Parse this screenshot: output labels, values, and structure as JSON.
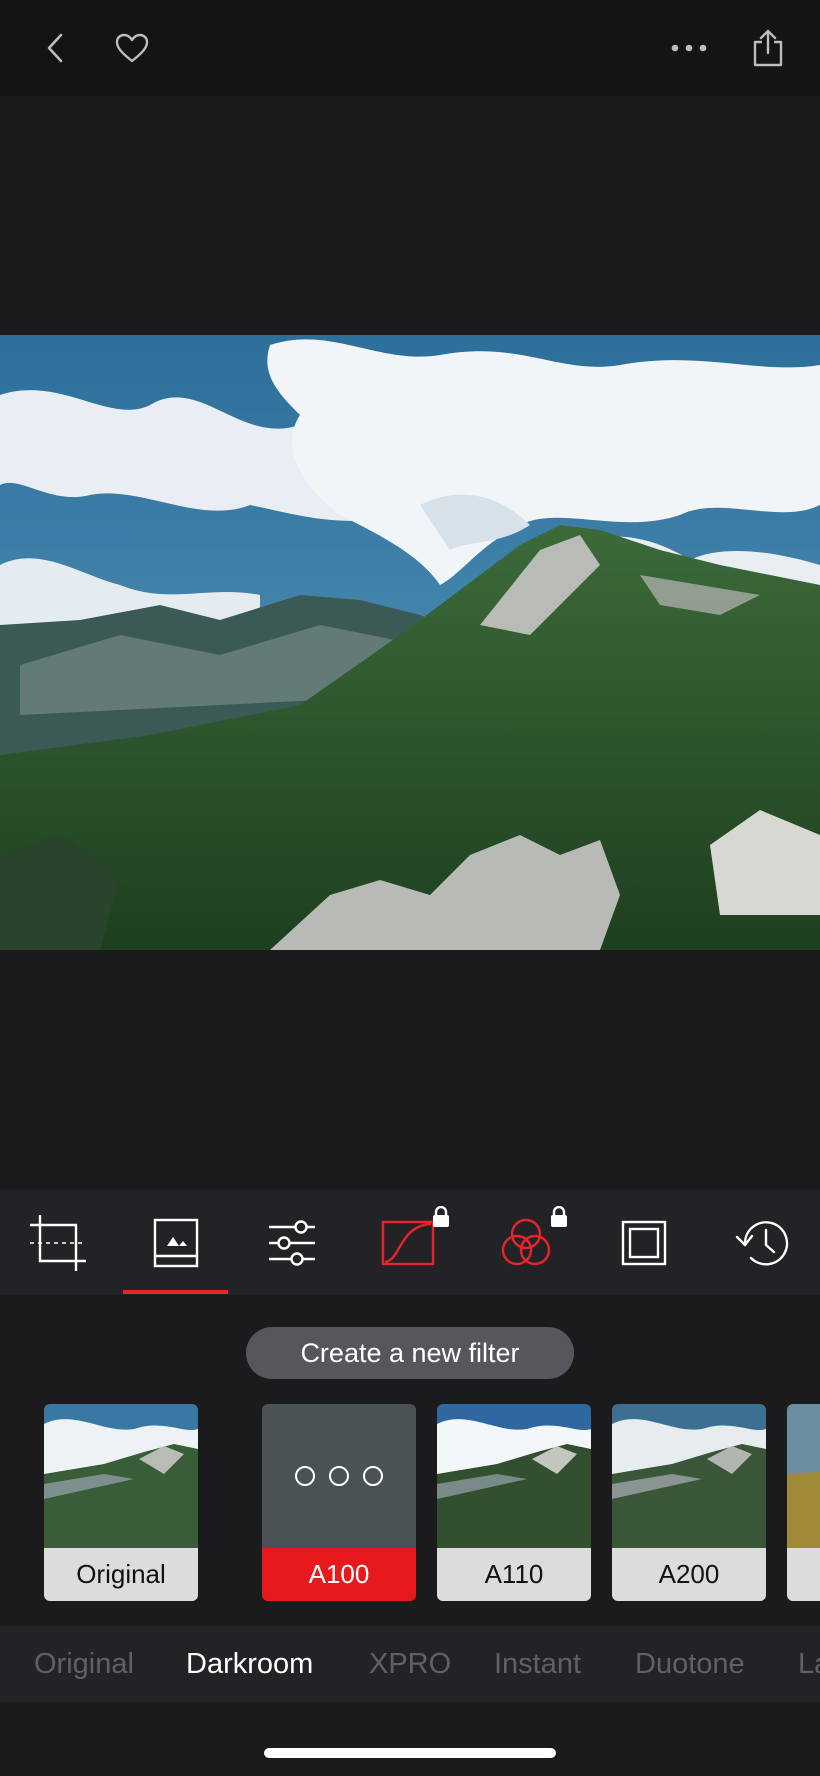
{
  "topbar": {
    "back_icon": "chevron-left-icon",
    "favorite_icon": "heart-icon",
    "more_icon": "ellipsis-icon",
    "share_icon": "share-icon"
  },
  "photo": {
    "subject": "mountain-landscape"
  },
  "toolbar": {
    "tools": [
      {
        "icon": "crop-icon",
        "locked": false
      },
      {
        "icon": "filters-icon",
        "locked": false,
        "active": true
      },
      {
        "icon": "adjust-sliders-icon",
        "locked": false
      },
      {
        "icon": "curves-icon",
        "locked": true
      },
      {
        "icon": "color-circles-icon",
        "locked": true
      },
      {
        "icon": "frame-icon",
        "locked": false
      },
      {
        "icon": "history-icon",
        "locked": false
      }
    ],
    "accent": "#e8242b"
  },
  "create_filter": {
    "label": "Create a new filter"
  },
  "filters": [
    {
      "label": "Original"
    },
    {
      "label": "A100",
      "selected": true
    },
    {
      "label": "A110"
    },
    {
      "label": "A200"
    }
  ],
  "categories": [
    {
      "label": "Original"
    },
    {
      "label": "Darkroom",
      "active": true
    },
    {
      "label": "XPRO"
    },
    {
      "label": "Instant"
    },
    {
      "label": "Duotone"
    },
    {
      "label": "La"
    }
  ]
}
